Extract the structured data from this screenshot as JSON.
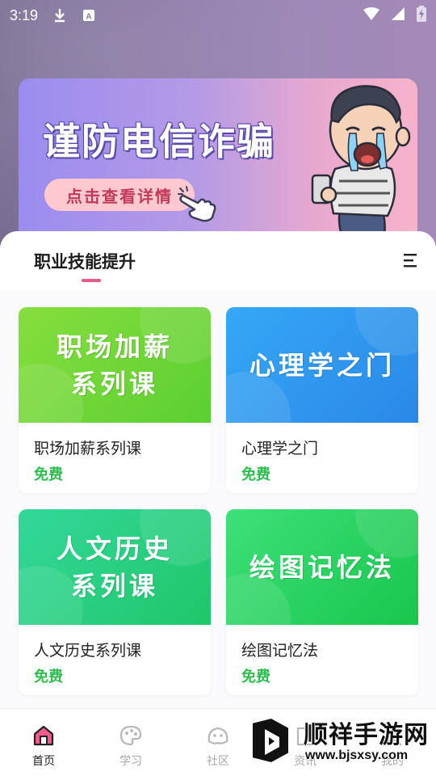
{
  "status_bar": {
    "time": "3:19",
    "icons": [
      "download-icon",
      "keyboard-a-icon",
      "wifi-icon",
      "signal-icon",
      "battery-charging-icon"
    ]
  },
  "banner": {
    "title": "谨防电信诈骗",
    "button_label": "点击查看详情"
  },
  "section": {
    "title": "职业技能提升",
    "menu_icon": "menu-icon"
  },
  "courses": [
    {
      "cover_line1": "职场加薪",
      "cover_line2": "系列课",
      "name": "职场加薪系列课",
      "price": "免费",
      "cover_color": "#6fd43a"
    },
    {
      "cover_line1": "心理学之门",
      "cover_line2": "",
      "name": "心理学之门",
      "price": "免费",
      "cover_color": "#2e9cf0"
    },
    {
      "cover_line1": "人文历史",
      "cover_line2": "系列课",
      "name": "人文历史系列课",
      "price": "免费",
      "cover_color": "#27d07e"
    },
    {
      "cover_line1": "绘图记忆法",
      "cover_line2": "",
      "name": "绘图记忆法",
      "price": "免费",
      "cover_color": "#2bd45a"
    }
  ],
  "bottom_nav": [
    {
      "label": "首页",
      "icon": "home-icon",
      "active": true
    },
    {
      "label": "学习",
      "icon": "palette-icon",
      "active": false
    },
    {
      "label": "社区",
      "icon": "ghost-icon",
      "active": false
    },
    {
      "label": "资讯",
      "icon": "news-icon",
      "active": false
    },
    {
      "label": "我的",
      "icon": "profile-icon",
      "active": false
    }
  ],
  "watermark": {
    "title": "顺祥手游网",
    "url": "www.bjsxsy.com"
  },
  "colors": {
    "accent": "#ea5a8a",
    "price": "#2ebd4e",
    "banner_btn_text": "#c23a5a"
  }
}
